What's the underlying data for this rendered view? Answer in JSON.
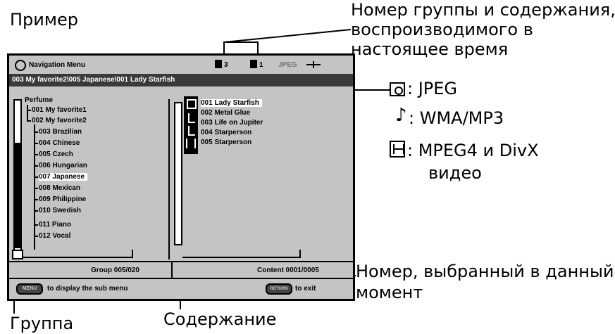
{
  "annotations": {
    "example": "Пример",
    "number_top_line1": "Номер группы и содержания,",
    "number_top_line2": "воспроизводимого в",
    "number_top_line3": "настоящее время",
    "jpeg": ": JPEG",
    "wma": ": WMA/MP3",
    "mpeg_line1": ": MPEG4 и DivX",
    "mpeg_line2": "видео",
    "selected_line1": "Номер, выбранный в данный",
    "selected_line2": "момент",
    "group": "Группа",
    "content": "Содержание"
  },
  "screen": {
    "title": "Navigation Menu",
    "group_num": "3",
    "content_num": "1",
    "format": "JPEG",
    "path": "003 My favorite2\\005 Japanese\\001 Lady Starfish",
    "tree_root": "Perfume",
    "groups": [
      "001 My favorite1",
      "002 My favorite2",
      "003 Brazilian",
      "004 Chinese",
      "005 Czech",
      "006 Hungarian",
      "007 Japanese",
      "008 Mexican",
      "009 Philippine",
      "010 Swedish",
      "011 Piano",
      "012 Vocal"
    ],
    "contents": [
      "001 Lady Starfish",
      "002 Metal Glue",
      "003 Life on Jupiter",
      "004 Starperson",
      "005 Starperson"
    ],
    "group_status": "Group 005/020",
    "content_status": "Content 0001/0005",
    "footer_left": "to display the sub menu",
    "footer_right": "to exit",
    "footer_left_key": "MENU",
    "footer_right_key": "RETURN"
  }
}
